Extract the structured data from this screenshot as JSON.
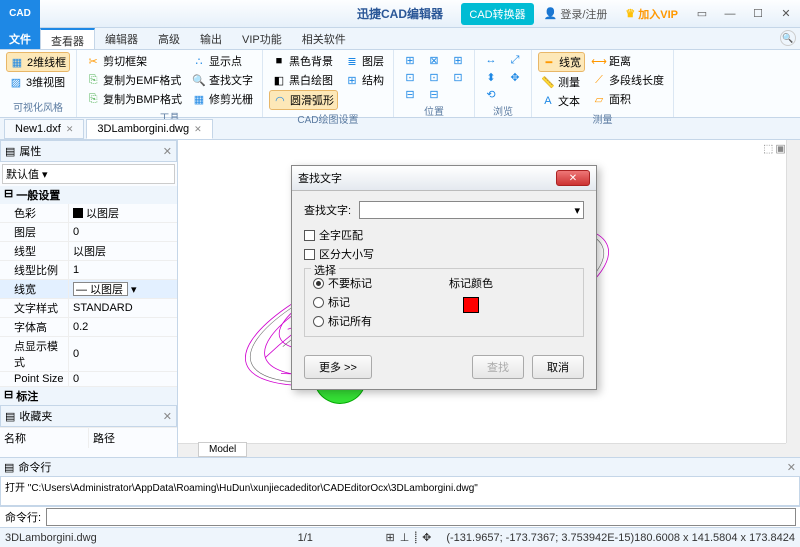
{
  "titlebar": {
    "app_badge": "CAD",
    "title": "迅捷CAD编辑器",
    "cad_conv": "CAD转换器",
    "login": "登录/注册",
    "vip": "加入VIP"
  },
  "menubar": {
    "file": "文件",
    "tabs": [
      "查看器",
      "编辑器",
      "高级",
      "输出",
      "VIP功能",
      "相关软件"
    ],
    "active": 0
  },
  "ribbon": {
    "g1": {
      "label": "可视化风格",
      "b1": "2维线框",
      "b2": "3维视图"
    },
    "g2": {
      "label": "工具",
      "b1": "剪切框架",
      "b2": "复制为EMF格式",
      "b3": "复制为BMP格式",
      "b4": "显示点",
      "b5": "查找文字",
      "b6": "修剪光栅"
    },
    "g3": {
      "label": "CAD绘图设置",
      "b1": "黑色背景",
      "b2": "黑白绘图",
      "b3": "圆滑弧形",
      "b4": "图层",
      "b5": "结构"
    },
    "g4": {
      "label": "位置"
    },
    "g5": {
      "label": "浏览"
    },
    "g6": {
      "label": "测量",
      "b1": "线宽",
      "b2": "测量",
      "b3": "文本",
      "b4": "距离",
      "b5": "多段线长度",
      "b6": "面积"
    }
  },
  "doc_tabs": [
    {
      "name": "New1.dxf"
    },
    {
      "name": "3DLamborgini.dwg"
    }
  ],
  "active_doc": 1,
  "panels": {
    "prop_title": "属性",
    "select": "默认值",
    "sections": {
      "general": "一般设置",
      "markers": "标注"
    },
    "rows": {
      "color": {
        "k": "色彩",
        "v": "以图层"
      },
      "layer": {
        "k": "图层",
        "v": "0"
      },
      "ltype": {
        "k": "线型",
        "v": "以图层"
      },
      "lscale": {
        "k": "线型比例",
        "v": "1"
      },
      "lw": {
        "k": "线宽",
        "v": "— 以图层"
      },
      "tstyle": {
        "k": "文字样式",
        "v": "STANDARD"
      },
      "theight": {
        "k": "字体高",
        "v": "0.2"
      },
      "pdmode": {
        "k": "点显示模式",
        "v": "0"
      },
      "psize": {
        "k": "Point Size",
        "v": "0"
      }
    },
    "fav_title": "收藏夹",
    "fav_cols": {
      "name": "名称",
      "path": "路径"
    }
  },
  "canvas": {
    "model_tab": "Model"
  },
  "cmdline": {
    "title": "命令行",
    "body": "打开 \"C:\\Users\\Administrator\\AppData\\Roaming\\HuDun\\xunjiecadeditor\\CADEditorOcx\\3DLamborgini.dwg\"",
    "label": "命令行:"
  },
  "statusbar": {
    "file": "3DLamborgini.dwg",
    "ratio": "1/1",
    "coords": "(-131.9657; -173.7367; 3.753942E-15)",
    "dims": "180.6008 x 141.5804 x 173.8424"
  },
  "dialog": {
    "title": "查找文字",
    "find_label": "查找文字:",
    "chk1": "全字匹配",
    "chk2": "区分大小写",
    "fs_title": "选择",
    "r1": "不要标记",
    "r2": "标记",
    "r3": "标记所有",
    "color_label": "标记颜色",
    "more": "更多 >>",
    "find": "查找",
    "cancel": "取消"
  }
}
